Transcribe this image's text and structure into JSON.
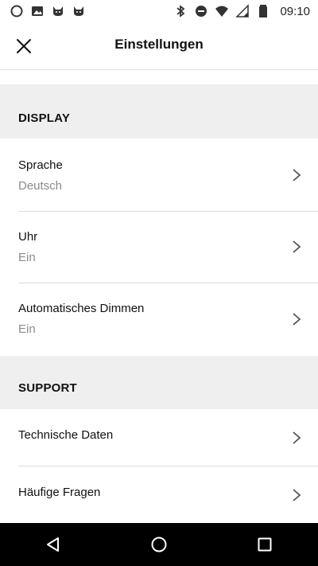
{
  "status_bar": {
    "time": "09:10",
    "left_icons": [
      "circle-notification-icon",
      "photo-icon",
      "cat-icon",
      "cat-icon"
    ],
    "right_icons": [
      "bluetooth-icon",
      "do-not-disturb-icon",
      "wifi-icon",
      "cellular-signal-icon",
      "battery-icon"
    ]
  },
  "header": {
    "title": "Einstellungen",
    "close_icon": "close-icon"
  },
  "sections": {
    "display": {
      "heading": "DISPLAY",
      "items": [
        {
          "label": "Sprache",
          "value": "Deutsch"
        },
        {
          "label": "Uhr",
          "value": "Ein"
        },
        {
          "label": "Automatisches Dimmen",
          "value": "Ein"
        }
      ]
    },
    "support": {
      "heading": "SUPPORT",
      "items": [
        {
          "label": "Technische Daten"
        },
        {
          "label": "Häufige Fragen"
        }
      ]
    }
  },
  "nav_bar": {
    "buttons": [
      "back-icon",
      "home-icon",
      "recents-icon"
    ]
  },
  "colors": {
    "section_background": "#efefef",
    "secondary_text": "#8a8a8a",
    "nav_background": "#000000"
  }
}
